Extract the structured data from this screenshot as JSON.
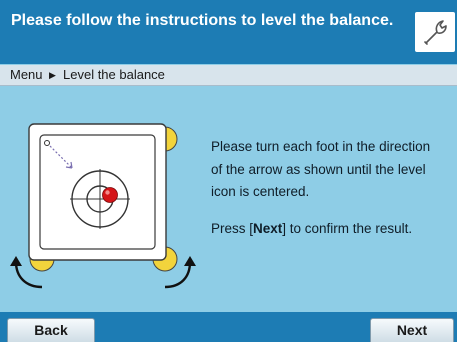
{
  "header": {
    "title": "Please follow the instructions to level the balance.",
    "settings_icon": "wrench-icon"
  },
  "breadcrumb": {
    "root": "Menu",
    "separator": "▶",
    "current": "Level the balance"
  },
  "illustration": {
    "feet_color": "#f2d43c",
    "bubble_color": "#d41418",
    "icons": [
      "level-indicator-icon",
      "rotate-arrow-icon"
    ]
  },
  "instructions": {
    "line1": "Please turn each foot in the direction of the arrow as shown until the level icon is centered.",
    "line2_before": "Press [",
    "line2_bold": "Next",
    "line2_after": "] to confirm the result."
  },
  "footer": {
    "back_label": "Back",
    "next_label": "Next"
  },
  "colors": {
    "header": "#1d7cb4",
    "background": "#8ecde6",
    "breadcrumb": "#d8e4ec"
  }
}
